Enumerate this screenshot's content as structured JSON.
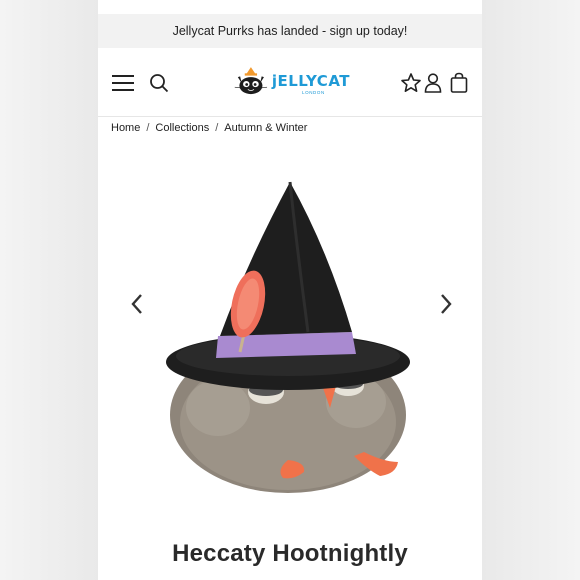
{
  "promo": {
    "text": "Jellycat Purrks has landed - sign up today!"
  },
  "header": {
    "logo": {
      "name": "jELLYCAT",
      "sub": "LONDON"
    },
    "icons": [
      "menu-icon",
      "search-icon",
      "wishlist-star-icon",
      "account-icon",
      "bag-icon"
    ]
  },
  "breadcrumb": {
    "items": [
      "Home",
      "Collections",
      "Autumn & Winter"
    ],
    "separator": "/"
  },
  "product": {
    "title": "Heccaty Hootnightly",
    "image": "heccaty-hootnightly-plush-owl-in-witch-hat"
  },
  "colors": {
    "accent": "#1f9ad6",
    "text": "#222222",
    "promo_bg": "#f2f2f2"
  }
}
